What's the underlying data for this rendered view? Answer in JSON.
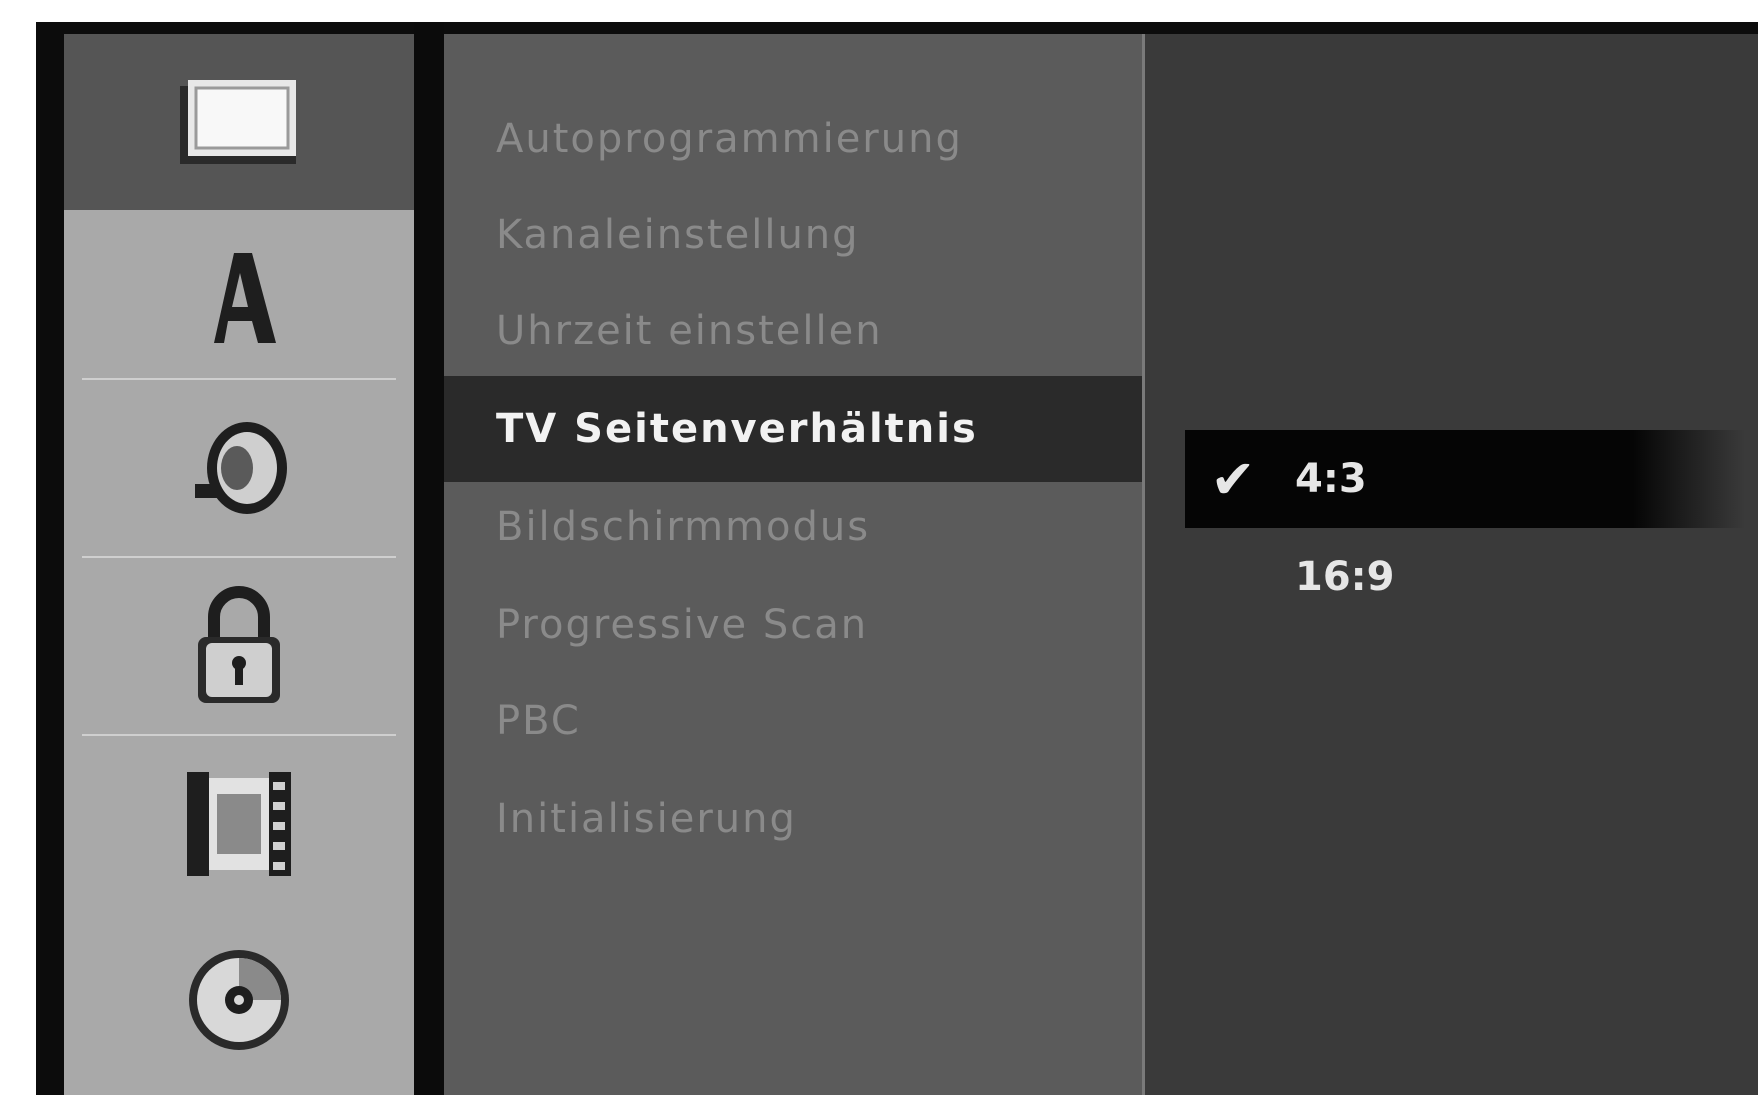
{
  "menu": {
    "items": [
      {
        "label": "Autoprogrammierung",
        "selected": false
      },
      {
        "label": "Kanaleinstellung",
        "selected": false
      },
      {
        "label": "Uhrzeit einstellen",
        "selected": false
      },
      {
        "label": "TV Seitenverhältnis",
        "selected": true
      },
      {
        "label": "Bildschirmmodus",
        "selected": false
      },
      {
        "label": "Progressive Scan",
        "selected": false
      },
      {
        "label": "PBC",
        "selected": false
      },
      {
        "label": "Initialisierung",
        "selected": false
      }
    ]
  },
  "options": {
    "items": [
      {
        "label": "4:3",
        "checked": true
      },
      {
        "label": "16:9",
        "checked": false
      }
    ]
  },
  "sidebar": {
    "icons": [
      "screen-icon",
      "language-icon",
      "speaker-icon",
      "lock-icon",
      "film-icon",
      "disc-icon"
    ],
    "active_index": 0
  },
  "colors": {
    "menu_bg": "#5b5b5b",
    "options_bg": "#3a3a3a",
    "sidebar_bg": "#a9a9a9",
    "selected_text": "#f2f2f2",
    "dim_text": "#8a8a8a"
  }
}
